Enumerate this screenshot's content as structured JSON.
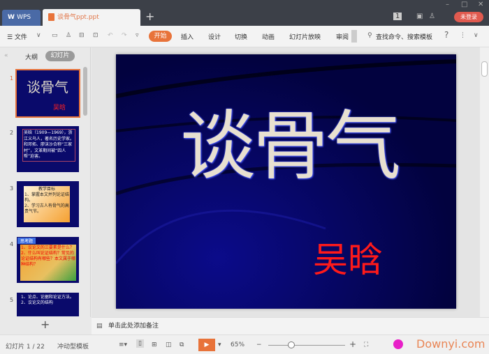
{
  "titlebar": {
    "wps_tab": "WPS",
    "doc_tab": "谈骨气ppt.ppt",
    "new_tab": "+",
    "page_badge": "1",
    "login": "未登录",
    "min": "–",
    "max": "□",
    "close": "✕"
  },
  "toolbar": {
    "menu": "☰ 文件",
    "tabs": [
      "开始",
      "插入",
      "设计",
      "切换",
      "动画",
      "幻灯片放映",
      "审阅"
    ],
    "search": "查找命令、搜索模板",
    "help": "?",
    "more": "⋮",
    "collapse": "∨"
  },
  "left_panel": {
    "collapse": "«",
    "outline_tab": "大纲",
    "slides_tab": "幻灯片",
    "add": "+",
    "slides": [
      {
        "num": "1",
        "title": "谈骨气",
        "author": "吴晗"
      },
      {
        "num": "2",
        "text": "吴晗（1909—1969），浙江义乌人，著名历史学家。和邓拓、廖沫沙合称“三家村”，文革期间被“四人帮”迫害。"
      },
      {
        "num": "3",
        "heading": "教学目标",
        "lines": [
          "1、掌握本文并列论证结构。",
          "2、学习古人有骨气的高贵气节。"
        ]
      },
      {
        "num": "4",
        "tag": "思考题",
        "lines": [
          "1、议论文的三要素是什么？",
          "2、什么叫论证结构？常见的论证结构有哪些？本文属于哪种结构？"
        ]
      },
      {
        "num": "5",
        "lines": [
          "1、论点、论据和论证方法。",
          "2、议论文的结构"
        ]
      }
    ]
  },
  "slide": {
    "title": "谈骨气",
    "author": "吴晗"
  },
  "notes": {
    "placeholder": "单击此处添加备注"
  },
  "status": {
    "slide_counter": "幻灯片 1 / 22",
    "template": "冲动型模板",
    "zoom": "65%",
    "zoom_level": 0.5,
    "minus": "−",
    "plus": "+",
    "watermark": "Downyi.com"
  },
  "colors": {
    "accent": "#e8733a",
    "slide_bg": "#02023f",
    "author": "#ff1a1a"
  }
}
